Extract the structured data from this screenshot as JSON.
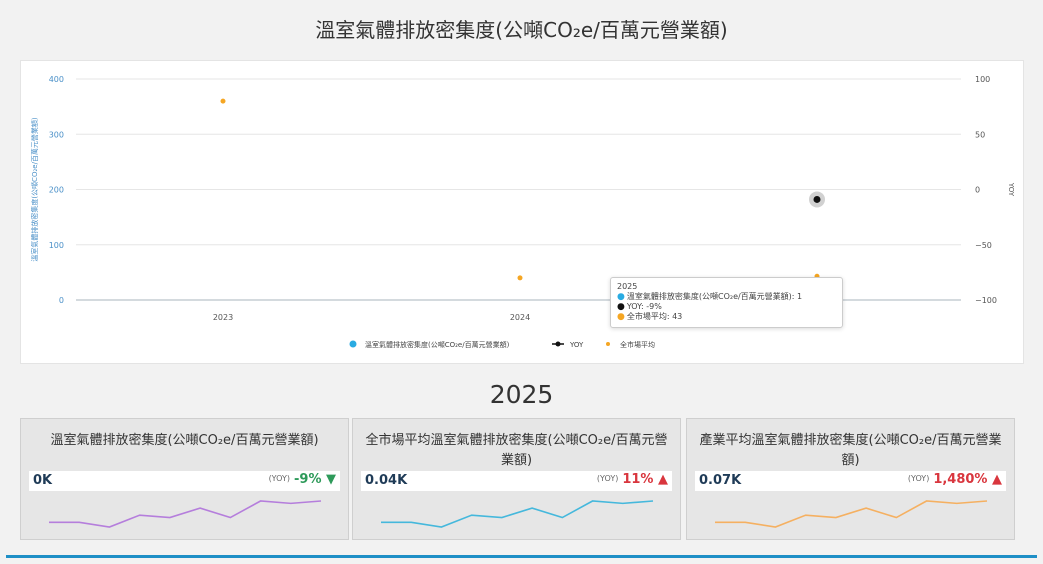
{
  "title": "溫室氣體排放密集度(公噸CO₂e/百萬元營業額)",
  "chart_data": {
    "type": "line",
    "categories": [
      "2023",
      "2024",
      "2025"
    ],
    "series": [
      {
        "name": "溫室氣體排放密集度(公噸CO₂e/百萬元營業額)",
        "axis": "left",
        "values": [
          null,
          null,
          1
        ],
        "color": "#29abe2",
        "marker": "circle"
      },
      {
        "name": "YOY",
        "axis": "right",
        "values": [
          null,
          null,
          -9
        ],
        "color": "#111111",
        "marker": "circle"
      },
      {
        "name": "全市場平均",
        "axis": "left",
        "values": [
          360,
          40,
          43
        ],
        "color": "#f5a623",
        "marker": "circle"
      }
    ],
    "ylabel": "溫室氣體排放密集度(公噸CO₂e/百萬元營業額)",
    "y2label": "YOY",
    "ylim": [
      0,
      400
    ],
    "y_ticks": [
      "400",
      "300",
      "200",
      "100",
      "0"
    ],
    "y2lim": [
      -100,
      100
    ],
    "y2_ticks": [
      "100",
      "50",
      "0",
      "−50",
      "−100"
    ],
    "grid": true,
    "legend_position": "bottom"
  },
  "tooltip": {
    "header": "2025",
    "rows": [
      {
        "text": "溫室氣體排放密集度(公噸CO₂e/百萬元營業額): 1",
        "color": "#29abe2"
      },
      {
        "text": "YOY: -9%",
        "color": "#111111"
      },
      {
        "text": "全市場平均: 43",
        "color": "#f5a623"
      }
    ]
  },
  "year_heading": "2025",
  "yoy_label": "(YOY)",
  "cards": [
    {
      "title": "溫室氣體排放密集度(公噸CO₂e/百萬元營業額)",
      "value": "0K",
      "yoy": "-9%",
      "direction": "down",
      "yoy_color": "#2e9a5a",
      "spark_color": "#b57edc",
      "spark": [
        3,
        3,
        1,
        6,
        5,
        9,
        5,
        12,
        11,
        12
      ]
    },
    {
      "title": "全市場平均溫室氣體排放密集度(公噸CO₂e/百萬元營業額)",
      "value": "0.04K",
      "yoy": "11%",
      "direction": "up",
      "yoy_color": "#d9363e",
      "spark_color": "#45b8dc",
      "spark": [
        3,
        3,
        1,
        6,
        5,
        9,
        5,
        12,
        11,
        12
      ]
    },
    {
      "title": "產業平均溫室氣體排放密集度(公噸CO₂e/百萬元營業額)",
      "value": "0.07K",
      "yoy": "1,480%",
      "direction": "up",
      "yoy_color": "#d9363e",
      "spark_color": "#f5b061",
      "spark": [
        3,
        3,
        1,
        6,
        5,
        9,
        5,
        12,
        11,
        12
      ]
    }
  ]
}
